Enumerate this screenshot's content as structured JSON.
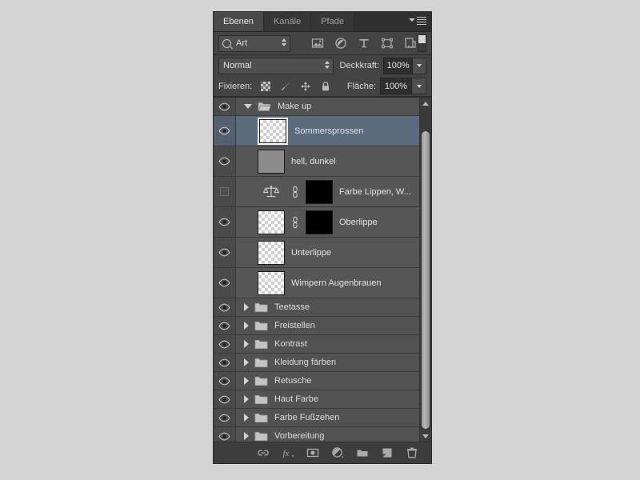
{
  "panel": {
    "tabs": [
      {
        "label": "Ebenen",
        "active": true
      },
      {
        "label": "Kanäle",
        "active": false
      },
      {
        "label": "Pfade",
        "active": false
      }
    ],
    "menu_icon": "panel-menu-icon"
  },
  "filter": {
    "kind_label": "Art",
    "search_icon": "search-icon",
    "icons": [
      {
        "name": "filter-pixel-icon"
      },
      {
        "name": "filter-adjustment-icon"
      },
      {
        "name": "filter-type-icon"
      },
      {
        "name": "filter-shape-icon"
      },
      {
        "name": "filter-smart-object-icon"
      }
    ],
    "toggle_name": "filter-enable-toggle"
  },
  "blend": {
    "mode": "Normal",
    "opacity_label": "Deckkraft:",
    "opacity_value": "100%",
    "fill_label": "Fläche:",
    "fill_value": "100%"
  },
  "lock": {
    "label": "Fixieren:",
    "icons": [
      {
        "name": "lock-transparency-icon"
      },
      {
        "name": "lock-image-icon"
      },
      {
        "name": "lock-position-icon"
      },
      {
        "name": "lock-all-icon"
      }
    ]
  },
  "layers": [
    {
      "name": "Make up",
      "type": "group",
      "expanded": true,
      "visible": true,
      "selected": false,
      "thumb": "none"
    },
    {
      "name": "Sommersprossen",
      "type": "layer",
      "visible": true,
      "selected": true,
      "thumb": "transparent",
      "indent": true
    },
    {
      "name": "hell, dunkel",
      "type": "layer",
      "visible": true,
      "selected": false,
      "thumb": "solid",
      "indent": true
    },
    {
      "name": "Farbe Lippen, W...",
      "type": "adjustment",
      "visible": false,
      "selected": false,
      "thumb": "adjustment",
      "mask": true,
      "linked": true,
      "indent": true
    },
    {
      "name": "Oberlippe",
      "type": "layer",
      "visible": true,
      "selected": false,
      "thumb": "transparent",
      "mask": true,
      "linked": true,
      "indent": true
    },
    {
      "name": "Unterlippe",
      "type": "layer",
      "visible": true,
      "selected": false,
      "thumb": "transparent",
      "indent": true
    },
    {
      "name": "Wimpern Augenbrauen",
      "type": "layer",
      "visible": true,
      "selected": false,
      "thumb": "transparent",
      "indent": true
    },
    {
      "name": "Teetasse",
      "type": "group",
      "expanded": false,
      "visible": true,
      "selected": false
    },
    {
      "name": "Freistellen",
      "type": "group",
      "expanded": false,
      "visible": true,
      "selected": false
    },
    {
      "name": "Kontrast",
      "type": "group",
      "expanded": false,
      "visible": true,
      "selected": false
    },
    {
      "name": "Kleidung färben",
      "type": "group",
      "expanded": false,
      "visible": true,
      "selected": false
    },
    {
      "name": "Retusche",
      "type": "group",
      "expanded": false,
      "visible": true,
      "selected": false
    },
    {
      "name": "Haut Farbe",
      "type": "group",
      "expanded": false,
      "visible": true,
      "selected": false
    },
    {
      "name": "Farbe Fußzehen",
      "type": "group",
      "expanded": false,
      "visible": true,
      "selected": false
    },
    {
      "name": "Vorbereitung",
      "type": "group",
      "expanded": false,
      "visible": true,
      "selected": false
    }
  ],
  "bottom_toolbar": [
    {
      "name": "link-layers-icon"
    },
    {
      "name": "layer-style-fx-icon"
    },
    {
      "name": "add-layer-mask-icon"
    },
    {
      "name": "new-adjustment-layer-icon"
    },
    {
      "name": "new-group-icon"
    },
    {
      "name": "new-layer-icon"
    },
    {
      "name": "delete-layer-icon"
    }
  ],
  "colors": {
    "panel_bg": "#3b3b3b",
    "row_bg": "#565656",
    "selected_row": "#5c6a7e",
    "text": "#e3e3e3"
  }
}
